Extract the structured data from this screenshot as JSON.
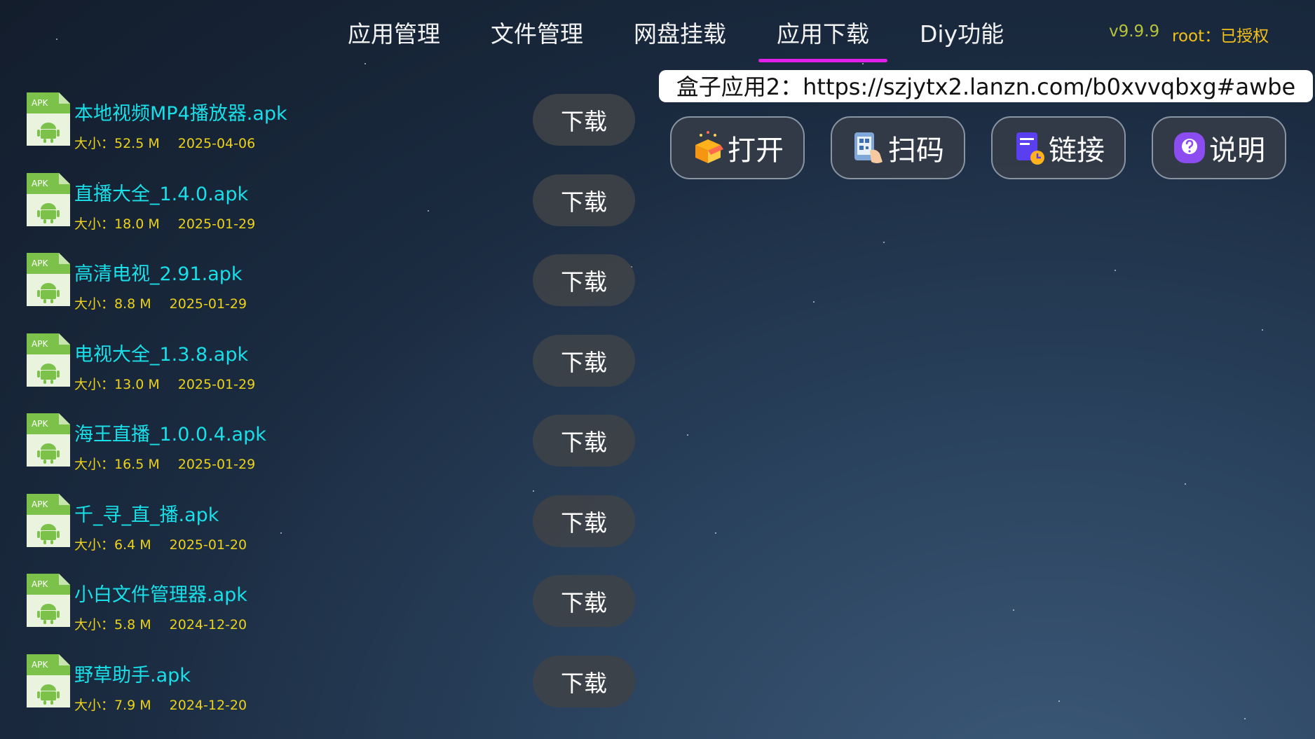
{
  "tabs": [
    {
      "label": "应用管理"
    },
    {
      "label": "文件管理"
    },
    {
      "label": "网盘挂载"
    },
    {
      "label": "应用下载",
      "active": true
    },
    {
      "label": "Diy功能"
    }
  ],
  "status": {
    "version": "v9.9.9",
    "root": "root：已授权"
  },
  "apps": [
    {
      "name": "本地视频MP4播放器.apk",
      "size": "大小：52.5 M",
      "date": "2025-04-06",
      "button": "下载"
    },
    {
      "name": "直播大全_1.4.0.apk",
      "size": "大小：18.0 M",
      "date": "2025-01-29",
      "button": "下载"
    },
    {
      "name": "高清电视_2.91.apk",
      "size": "大小：8.8 M",
      "date": "2025-01-29",
      "button": "下载"
    },
    {
      "name": "电视大全_1.3.8.apk",
      "size": "大小：13.0 M",
      "date": "2025-01-29",
      "button": "下载"
    },
    {
      "name": "海王直播_1.0.0.4.apk",
      "size": "大小：16.5 M",
      "date": "2025-01-29",
      "button": "下载"
    },
    {
      "name": "千_寻_直_播.apk",
      "size": "大小：6.4 M",
      "date": "2025-01-20",
      "button": "下载"
    },
    {
      "name": "小白文件管理器.apk",
      "size": "大小：5.8 M",
      "date": "2024-12-20",
      "button": "下载"
    },
    {
      "name": "野草助手.apk",
      "size": "大小：7.9 M",
      "date": "2024-12-20",
      "button": "下载"
    }
  ],
  "url_bar": "盒子应用2：https://szjytx2.lanzn.com/b0xvvqbxg#awbe",
  "actions": [
    {
      "label": "打开",
      "icon": "box-icon"
    },
    {
      "label": "扫码",
      "icon": "qr-scan-icon"
    },
    {
      "label": "链接",
      "icon": "link-doc-icon"
    },
    {
      "label": "说明",
      "icon": "help-icon"
    }
  ],
  "icon_label": "APK",
  "colors": {
    "app_name": "#19dfe8",
    "app_meta": "#ecd21a",
    "tab_indicator": "#e020e8",
    "version": "#b7c23a",
    "root": "#f2c019"
  }
}
